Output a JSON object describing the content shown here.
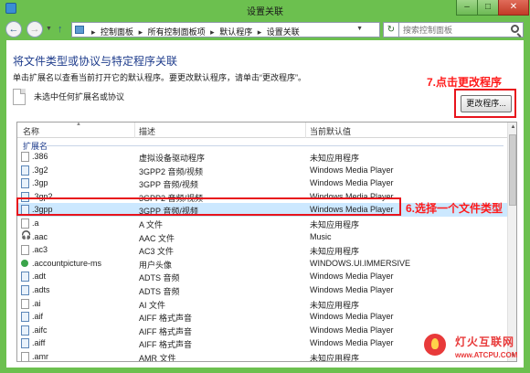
{
  "window": {
    "title": "设置关联",
    "minimize": "–",
    "maximize": "□",
    "close": "✕"
  },
  "nav": {
    "back": "←",
    "forward": "→",
    "up": "↑",
    "breadcrumbs": [
      "控制面板",
      "所有控制面板项",
      "默认程序",
      "设置关联"
    ],
    "refresh": "↻",
    "search_placeholder": "搜索控制面板"
  },
  "main": {
    "heading": "将文件类型或协议与特定程序关联",
    "description": "单击扩展名以查看当前打开它的默认程序。要更改默认程序，请单击“更改程序”。",
    "no_selection": "未选中任何扩展名或协议",
    "change_button": "更改程序..."
  },
  "annotations": {
    "step7": "7.点击更改程序",
    "step6": "6.选择一个文件类型"
  },
  "list": {
    "columns": [
      "名称",
      "描述",
      "当前默认值"
    ],
    "group": "扩展名",
    "rows": [
      {
        "name": ".386",
        "desc": "虚拟设备驱动程序",
        "default": "未知应用程序",
        "icon": "file-icon"
      },
      {
        "name": ".3g2",
        "desc": "3GPP2 音频/视频",
        "default": "Windows Media Player",
        "icon": "media-file-icon"
      },
      {
        "name": ".3gp",
        "desc": "3GPP 音频/视频",
        "default": "Windows Media Player",
        "icon": "media-file-icon"
      },
      {
        "name": ".3gp2",
        "desc": "3GPP2 音频/视频",
        "default": "Windows Media Player",
        "icon": "media-file-icon"
      },
      {
        "name": ".3gpp",
        "desc": "3GPP 音频/视频",
        "default": "Windows Media Player",
        "icon": "media-file-icon"
      },
      {
        "name": ".a",
        "desc": "A 文件",
        "default": "未知应用程序",
        "icon": "file-icon"
      },
      {
        "name": ".aac",
        "desc": "AAC 文件",
        "default": "Music",
        "icon": "headphones-icon"
      },
      {
        "name": ".ac3",
        "desc": "AC3 文件",
        "default": "未知应用程序",
        "icon": "file-icon"
      },
      {
        "name": ".accountpicture-ms",
        "desc": "用户头像",
        "default": "WINDOWS.UI.IMMERSIVE",
        "icon": "user-icon"
      },
      {
        "name": ".adt",
        "desc": "ADTS 音频",
        "default": "Windows Media Player",
        "icon": "media-file-icon"
      },
      {
        "name": ".adts",
        "desc": "ADTS 音频",
        "default": "Windows Media Player",
        "icon": "media-file-icon"
      },
      {
        "name": ".ai",
        "desc": "AI 文件",
        "default": "未知应用程序",
        "icon": "file-icon"
      },
      {
        "name": ".aif",
        "desc": "AIFF 格式声音",
        "default": "Windows Media Player",
        "icon": "media-file-icon"
      },
      {
        "name": ".aifc",
        "desc": "AIFF 格式声音",
        "default": "Windows Media Player",
        "icon": "media-file-icon"
      },
      {
        "name": ".aiff",
        "desc": "AIFF 格式声音",
        "default": "Windows Media Player",
        "icon": "media-file-icon"
      },
      {
        "name": ".amr",
        "desc": "AMR 文件",
        "default": "未知应用程序",
        "icon": "file-icon"
      }
    ]
  },
  "watermark": {
    "cn": "灯火互联网",
    "en": "www.ATCPU.COM"
  },
  "colors": {
    "frame": "#6cc04f",
    "heading": "#1e3c8c",
    "annotation": "#ff1a1a",
    "selected_row": "#cce8ff"
  }
}
